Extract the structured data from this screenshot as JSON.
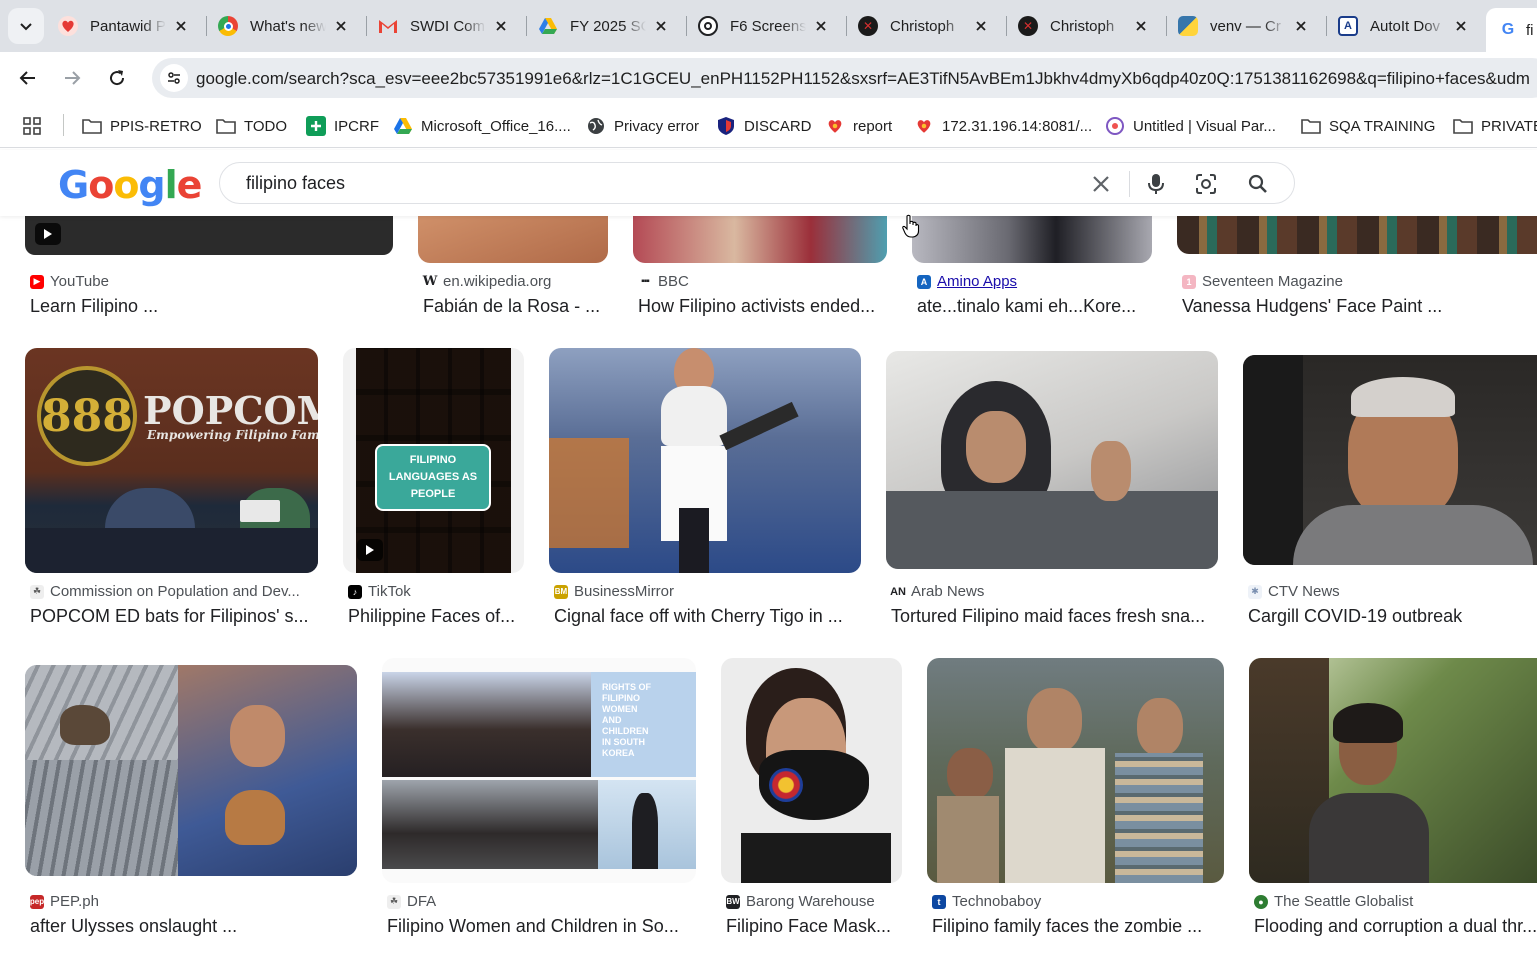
{
  "browser": {
    "tabs": [
      {
        "title": "Pantawid P",
        "favicon": "heart-hands-icon",
        "color": "#e53935"
      },
      {
        "title": "What's new",
        "favicon": "chrome-icon",
        "color": "#1a73e8"
      },
      {
        "title": "SWDI Com",
        "favicon": "gmail-icon",
        "color": "#ea4335"
      },
      {
        "title": "FY 2025 SC",
        "favicon": "drive-icon",
        "color": "#34a853"
      },
      {
        "title": "F6 Screens",
        "favicon": "openai-icon",
        "color": "#202124"
      },
      {
        "title": "Christoph",
        "favicon": "x-logo-icon",
        "color": "#8b0000"
      },
      {
        "title": "Christoph",
        "favicon": "x-logo-icon",
        "color": "#8b0000"
      },
      {
        "title": "venv — Cr",
        "favicon": "python-icon",
        "color": "#3776ab"
      },
      {
        "title": "AutoIt Dov",
        "favicon": "autoit-icon",
        "color": "#1a3c8a"
      },
      {
        "title": "fi",
        "favicon": "google-icon",
        "color": "#4285f4"
      }
    ],
    "url": "google.com/search?sca_esv=eee2bc57351991e6&rlz=1C1GCEU_enPH1152PH1152&sxsrf=AE3TifN5AvBEm1Jbkhv4dmyXb6qdp40z0Q:1751381162698&q=filipino+faces&udm",
    "bookmarks": [
      {
        "label": "PPIS-RETRO",
        "icon": "folder-icon"
      },
      {
        "label": "TODO",
        "icon": "folder-icon"
      },
      {
        "label": "IPCRF",
        "icon": "plus-green-icon"
      },
      {
        "label": "Microsoft_Office_16....",
        "icon": "drive-icon"
      },
      {
        "label": "Privacy error",
        "icon": "globe-icon"
      },
      {
        "label": "DISCARD",
        "icon": "shield-icon"
      },
      {
        "label": "report",
        "icon": "heart-hands-icon"
      },
      {
        "label": "172.31.196.14:8081/...",
        "icon": "heart-hands-icon"
      },
      {
        "label": "Untitled | Visual Par...",
        "icon": "vp-icon"
      },
      {
        "label": "SQA TRAINING",
        "icon": "folder-icon"
      },
      {
        "label": "PRIVATE",
        "icon": "folder-icon"
      }
    ]
  },
  "google": {
    "logo": "Google",
    "query": "filipino faces"
  },
  "results": [
    {
      "source": "YouTube",
      "title": "Learn Filipino ...",
      "icon_color": "#ff0000",
      "icon": "youtube-icon",
      "thumb_bg": "#2b2b2b",
      "video": true
    },
    {
      "source": "en.wikipedia.org",
      "title": "Fabián de la Rosa - ...",
      "icon_color": "#202124",
      "icon": "wikipedia-icon",
      "thumb_bg": "#c98760"
    },
    {
      "source": "BBC",
      "title": "How Filipino activists ended...",
      "icon_color": "#202124",
      "icon": "bbc-icon",
      "thumb_bg": "#b44a55"
    },
    {
      "source": "Amino Apps",
      "title": "ate...tinalo kami eh...Kore...",
      "icon_color": "#1565c0",
      "icon": "amino-icon",
      "thumb_bg": "#9a9aa4"
    },
    {
      "source": "Seventeen Magazine",
      "title": "Vanessa Hudgens' Face Paint ...",
      "icon_color": "#f4b6c2",
      "icon": "seventeen-icon",
      "thumb_bg": "#4a3a30"
    },
    {
      "source": "Commission on Population and Dev...",
      "title": "POPCOM ED bats for Filipinos' s...",
      "icon_color": "#9e9e9e",
      "icon": "popcom-icon",
      "thumb_bg": "#5a2e1e",
      "overlay": "POPCOM",
      "overlay2": "Empowering Filipino Famili"
    },
    {
      "source": "TikTok",
      "title": "Philippine Faces of...",
      "icon_color": "#000000",
      "icon": "tiktok-icon",
      "thumb_bg": "#3b3530",
      "video": true,
      "overlay": "FILIPINO LANGUAGES AS PEOPLE"
    },
    {
      "source": "BusinessMirror",
      "title": "Cignal face off with Cherry Tigo in ...",
      "icon_color": "#caa200",
      "icon": "businessmirror-icon",
      "thumb_bg": "#6a7fa8"
    },
    {
      "source": "Arab News",
      "title": "Tortured Filipino maid faces fresh sna...",
      "icon_color": "#202124",
      "icon": "arabnews-icon",
      "thumb_bg": "#c9c8c6"
    },
    {
      "source": "CTV News",
      "title": "Cargill COVID-19 outbreak",
      "icon_color": "#7a8fb0",
      "icon": "ctv-icon",
      "thumb_bg": "#3c3a38"
    },
    {
      "source": "PEP.ph",
      "title": "after Ulysses onslaught ...",
      "icon_color": "#c62828",
      "icon": "pep-icon",
      "thumb_bg": "#6b7c9a"
    },
    {
      "source": "DFA",
      "title": "Filipino Women and Children in So...",
      "icon_color": "#9e9e9e",
      "icon": "dfa-icon",
      "thumb_bg": "#8f8a86"
    },
    {
      "source": "Barong Warehouse",
      "title": "Filipino Face Mask...",
      "icon_color": "#202124",
      "icon": "barong-icon",
      "thumb_bg": "#ececec"
    },
    {
      "source": "Technobaboy",
      "title": "Filipino family faces the zombie ...",
      "icon_color": "#0d47a1",
      "icon": "technobaboy-icon",
      "thumb_bg": "#6c7058"
    },
    {
      "source": "The Seattle Globalist",
      "title": "Flooding and corruption a dual thr...",
      "icon_color": "#2e7d32",
      "icon": "globalist-icon",
      "thumb_bg": "#4f5a3a"
    }
  ]
}
